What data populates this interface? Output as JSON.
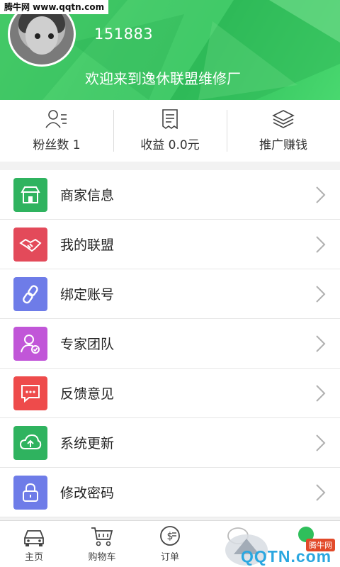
{
  "watermark": {
    "top_left": "腾牛网 www.qqtn.com",
    "corner_text": "QQTN.com",
    "corner_badge": "腾牛网"
  },
  "profile": {
    "phone": "151883",
    "welcome": "欢迎来到逸休联盟维修厂"
  },
  "stats": [
    {
      "label": "粉丝数 1",
      "icon": "person-list-icon"
    },
    {
      "label": "收益 0.0元",
      "icon": "receipt-icon"
    },
    {
      "label": "推广赚钱",
      "icon": "layers-icon"
    }
  ],
  "menu": [
    {
      "label": "商家信息",
      "icon": "store-icon",
      "color": "#2fb35f"
    },
    {
      "label": "我的联盟",
      "icon": "handshake-icon",
      "color": "#e34a5a"
    },
    {
      "label": "绑定账号",
      "icon": "link-icon",
      "color": "#6e7ce8"
    },
    {
      "label": "专家团队",
      "icon": "expert-user-icon",
      "color": "#c156d8"
    },
    {
      "label": "反馈意见",
      "icon": "chat-feedback-icon",
      "color": "#ee4b4b"
    },
    {
      "label": "系统更新",
      "icon": "cloud-upload-icon",
      "color": "#2fb35f"
    },
    {
      "label": "修改密码",
      "icon": "lock-icon",
      "color": "#6e7ce8"
    }
  ],
  "bottom_nav": [
    {
      "label": "主页",
      "icon": "car-icon"
    },
    {
      "label": "购物车",
      "icon": "cart-icon"
    },
    {
      "label": "订单",
      "icon": "order-icon"
    }
  ],
  "colors": {
    "accent": "#2fbf5b",
    "chevron": "#b0b0b0"
  }
}
